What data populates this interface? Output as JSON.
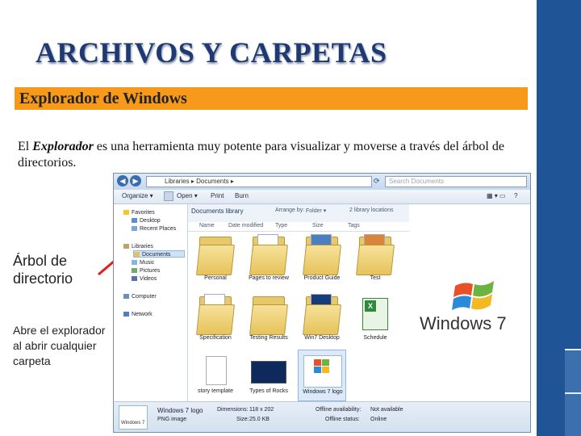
{
  "slide": {
    "title": "ARCHIVOS Y CARPETAS",
    "section_heading": "Explorador de Windows",
    "description_prefix": "El ",
    "description_bold": "Explorador",
    "description_rest": " es una herramienta muy potente para visualizar y moverse a través del árbol de directorios.",
    "side_label": "Árbol de directorio",
    "side_note": "Abre el explorador al abrir cualquier carpeta",
    "logo_text": "Windows 7",
    "colors": {
      "title": "#1f3a73",
      "heading_band": "#f79a1c",
      "right_bar": "#1f5596"
    }
  },
  "explorer": {
    "address": "Libraries ▸ Documents ▸",
    "search_placeholder": "Search Documents",
    "toolbar": {
      "organize": "Organize ▾",
      "open": "Open ▾",
      "print": "Print",
      "burn": "Burn"
    },
    "nav": {
      "favorites": "Favorites",
      "desktop": "Desktop",
      "recent": "Recent Places",
      "libraries": "Libraries",
      "documents": "Documents",
      "music": "Music",
      "pictures": "Pictures",
      "videos": "Videos",
      "computer": "Computer",
      "network": "Network"
    },
    "library_title": "Documents library",
    "arrange_by": "Arrange by:",
    "arrange_value": "Folder ▾",
    "library_locations": "2 library locations",
    "columns": {
      "name": "Name",
      "date": "Date modified",
      "type": "Type",
      "size": "Size",
      "tags": "Tags"
    },
    "items": {
      "i1": "Personal",
      "i2": "Pages to review",
      "i3": "Product Guide",
      "i4": "Test",
      "i5": "Specification",
      "i6": "Testing Results",
      "i7": "Win7 Desktop",
      "i8": "Schedule",
      "i9": "story template",
      "i10": "Types of Rocks",
      "i11": "Windows 7 logo"
    },
    "details": {
      "name": "Windows 7 logo",
      "kind": "PNG image",
      "dimensions_label": "Dimensions:",
      "dimensions": "118 x 202",
      "size_label": "Size:",
      "size": "25.0 KB",
      "offline_label": "Offline availability:",
      "offline": "Not available",
      "status_label": "Offline status:",
      "status": "Online",
      "thumb_text": "Windows 7"
    }
  }
}
